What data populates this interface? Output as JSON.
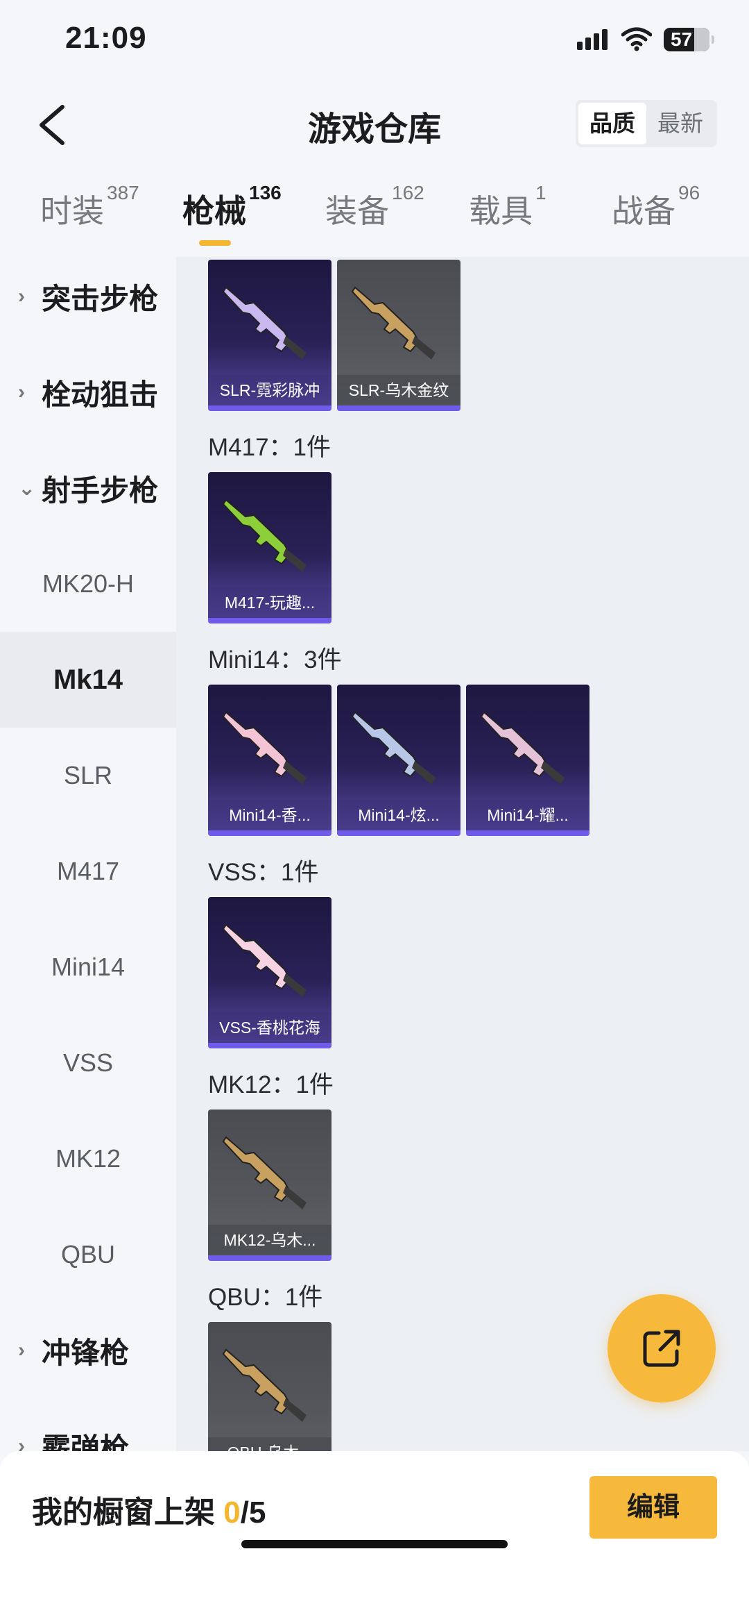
{
  "status_bar": {
    "time": "21:09",
    "battery": "57"
  },
  "header": {
    "title": "游戏仓库",
    "sort_options": [
      "品质",
      "最新"
    ],
    "sort_selected": "品质"
  },
  "tabs": [
    {
      "label": "时装",
      "count": "387"
    },
    {
      "label": "枪械",
      "count": "136",
      "active": true
    },
    {
      "label": "装备",
      "count": "162"
    },
    {
      "label": "载具",
      "count": "1"
    },
    {
      "label": "战备",
      "count": "96"
    }
  ],
  "sidebar": {
    "items": [
      {
        "label": "突击步枪",
        "type": "category",
        "arrow": "›"
      },
      {
        "label": "栓动狙击",
        "type": "category",
        "arrow": "›"
      },
      {
        "label": "射手步枪",
        "type": "category",
        "arrow": "⌄"
      },
      {
        "label": "MK20-H"
      },
      {
        "label": "Mk14",
        "selected": true
      },
      {
        "label": "SLR"
      },
      {
        "label": "M417"
      },
      {
        "label": "Mini14"
      },
      {
        "label": "VSS"
      },
      {
        "label": "MK12"
      },
      {
        "label": "QBU"
      },
      {
        "label": "冲锋枪",
        "type": "category",
        "arrow": "›"
      },
      {
        "label": "霰弹枪",
        "type": "category",
        "arrow": "›"
      }
    ]
  },
  "groups": [
    {
      "label": "",
      "items": [
        {
          "name": "SLR-霓彩脉冲",
          "rarity": "purple"
        },
        {
          "name": "SLR-乌木金纹",
          "rarity": "gray"
        }
      ]
    },
    {
      "label": "M417：1件",
      "items": [
        {
          "name": "M417-玩趣...",
          "rarity": "purple"
        }
      ]
    },
    {
      "label": "Mini14：3件",
      "items": [
        {
          "name": "Mini14-香...",
          "rarity": "purple"
        },
        {
          "name": "Mini14-炫...",
          "rarity": "purple"
        },
        {
          "name": "Mini14-耀...",
          "rarity": "purple"
        }
      ]
    },
    {
      "label": "VSS：1件",
      "items": [
        {
          "name": "VSS-香桃花海",
          "rarity": "purple"
        }
      ]
    },
    {
      "label": "MK12：1件",
      "items": [
        {
          "name": "MK12-乌木...",
          "rarity": "gray"
        }
      ]
    },
    {
      "label": "QBU：1件",
      "items": [
        {
          "name": "QBU-乌木...",
          "rarity": "gray"
        }
      ]
    }
  ],
  "bottom_bar": {
    "showcase_label": "我的橱窗上架",
    "showcase_count": "0",
    "showcase_total": "/5",
    "edit_label": "编辑"
  },
  "icons": {
    "back": "chevron-left-icon",
    "fab": "share-external-icon"
  },
  "colors": {
    "accent": "#f6b93b",
    "purple_rarity": "#6c5ce7"
  }
}
